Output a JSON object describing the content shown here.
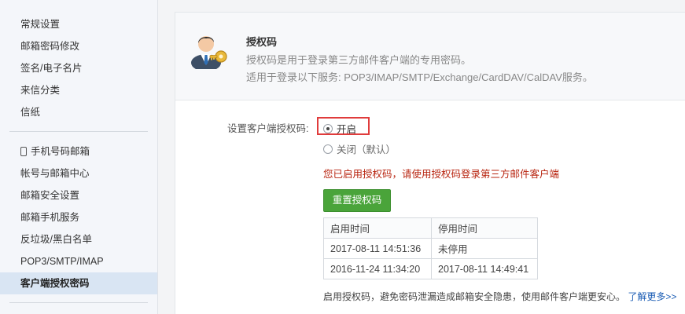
{
  "sidebar": {
    "group1": [
      "常规设置",
      "邮箱密码修改",
      "签名/电子名片",
      "来信分类",
      "信纸"
    ],
    "group2": [
      "手机号码邮箱",
      "帐号与邮箱中心",
      "邮箱安全设置",
      "邮箱手机服务",
      "反垃圾/黑白名单",
      "POP3/SMTP/IMAP",
      "客户端授权密码"
    ],
    "active": "客户端授权密码"
  },
  "header": {
    "title": "授权码",
    "desc": "授权码是用于登录第三方邮件客户端的专用密码。",
    "desc2": "适用于登录以下服务: POP3/IMAP/SMTP/Exchange/CardDAV/CalDAV服务。",
    "icon": "user-key-icon"
  },
  "form": {
    "label": "设置客户端授权码:",
    "option_on": "开启",
    "option_off": "关闭（默认）",
    "selected": "开启"
  },
  "notice": "您已启用授权码，请使用授权码登录第三方邮件客户端",
  "reset_button": "重置授权码",
  "history": {
    "headers": [
      "启用时间",
      "停用时间"
    ],
    "rows": [
      [
        "2017-08-11 14:51:36",
        "未停用"
      ],
      [
        "2016-11-24 11:34:20",
        "2017-08-11 14:49:41"
      ]
    ]
  },
  "footer": {
    "text": "启用授权码，避免密码泄漏造成邮箱安全隐患，使用邮件客户端更安心。",
    "link": "了解更多>>"
  },
  "colors": {
    "notice": "#b8240f",
    "button": "#4aa43a",
    "highlight_box": "#e03c3c",
    "link": "#1a5cb4",
    "active_nav": "#d9e5f3"
  }
}
